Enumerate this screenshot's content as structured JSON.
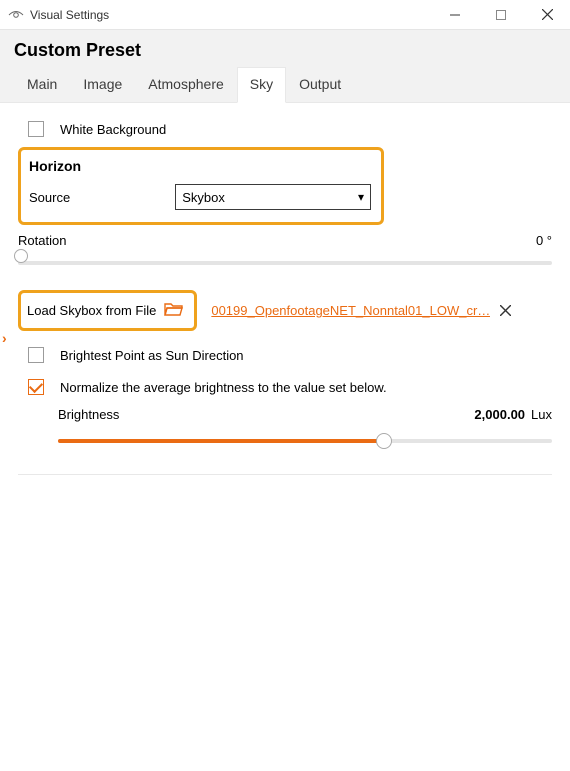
{
  "window": {
    "title": "Visual Settings"
  },
  "preset_title": "Custom Preset",
  "tabs": {
    "main": "Main",
    "image": "Image",
    "atmosphere": "Atmosphere",
    "sky": "Sky",
    "output": "Output",
    "active": "sky"
  },
  "sky": {
    "white_background_label": "White Background",
    "white_background_checked": false,
    "horizon_title": "Horizon",
    "source_label": "Source",
    "source_value": "Skybox",
    "rotation_label": "Rotation",
    "rotation_value": "0",
    "rotation_unit": "°",
    "load_from_file_label": "Load Skybox from File",
    "file_name": "00199_OpenfootageNET_Nonntal01_LOW_cr…",
    "brightest_point_label": "Brightest Point as Sun Direction",
    "brightest_point_checked": false,
    "normalize_label": "Normalize the average brightness to the value set below.",
    "normalize_checked": true,
    "brightness_label": "Brightness",
    "brightness_value": "2,000.00",
    "brightness_unit": "Lux"
  }
}
